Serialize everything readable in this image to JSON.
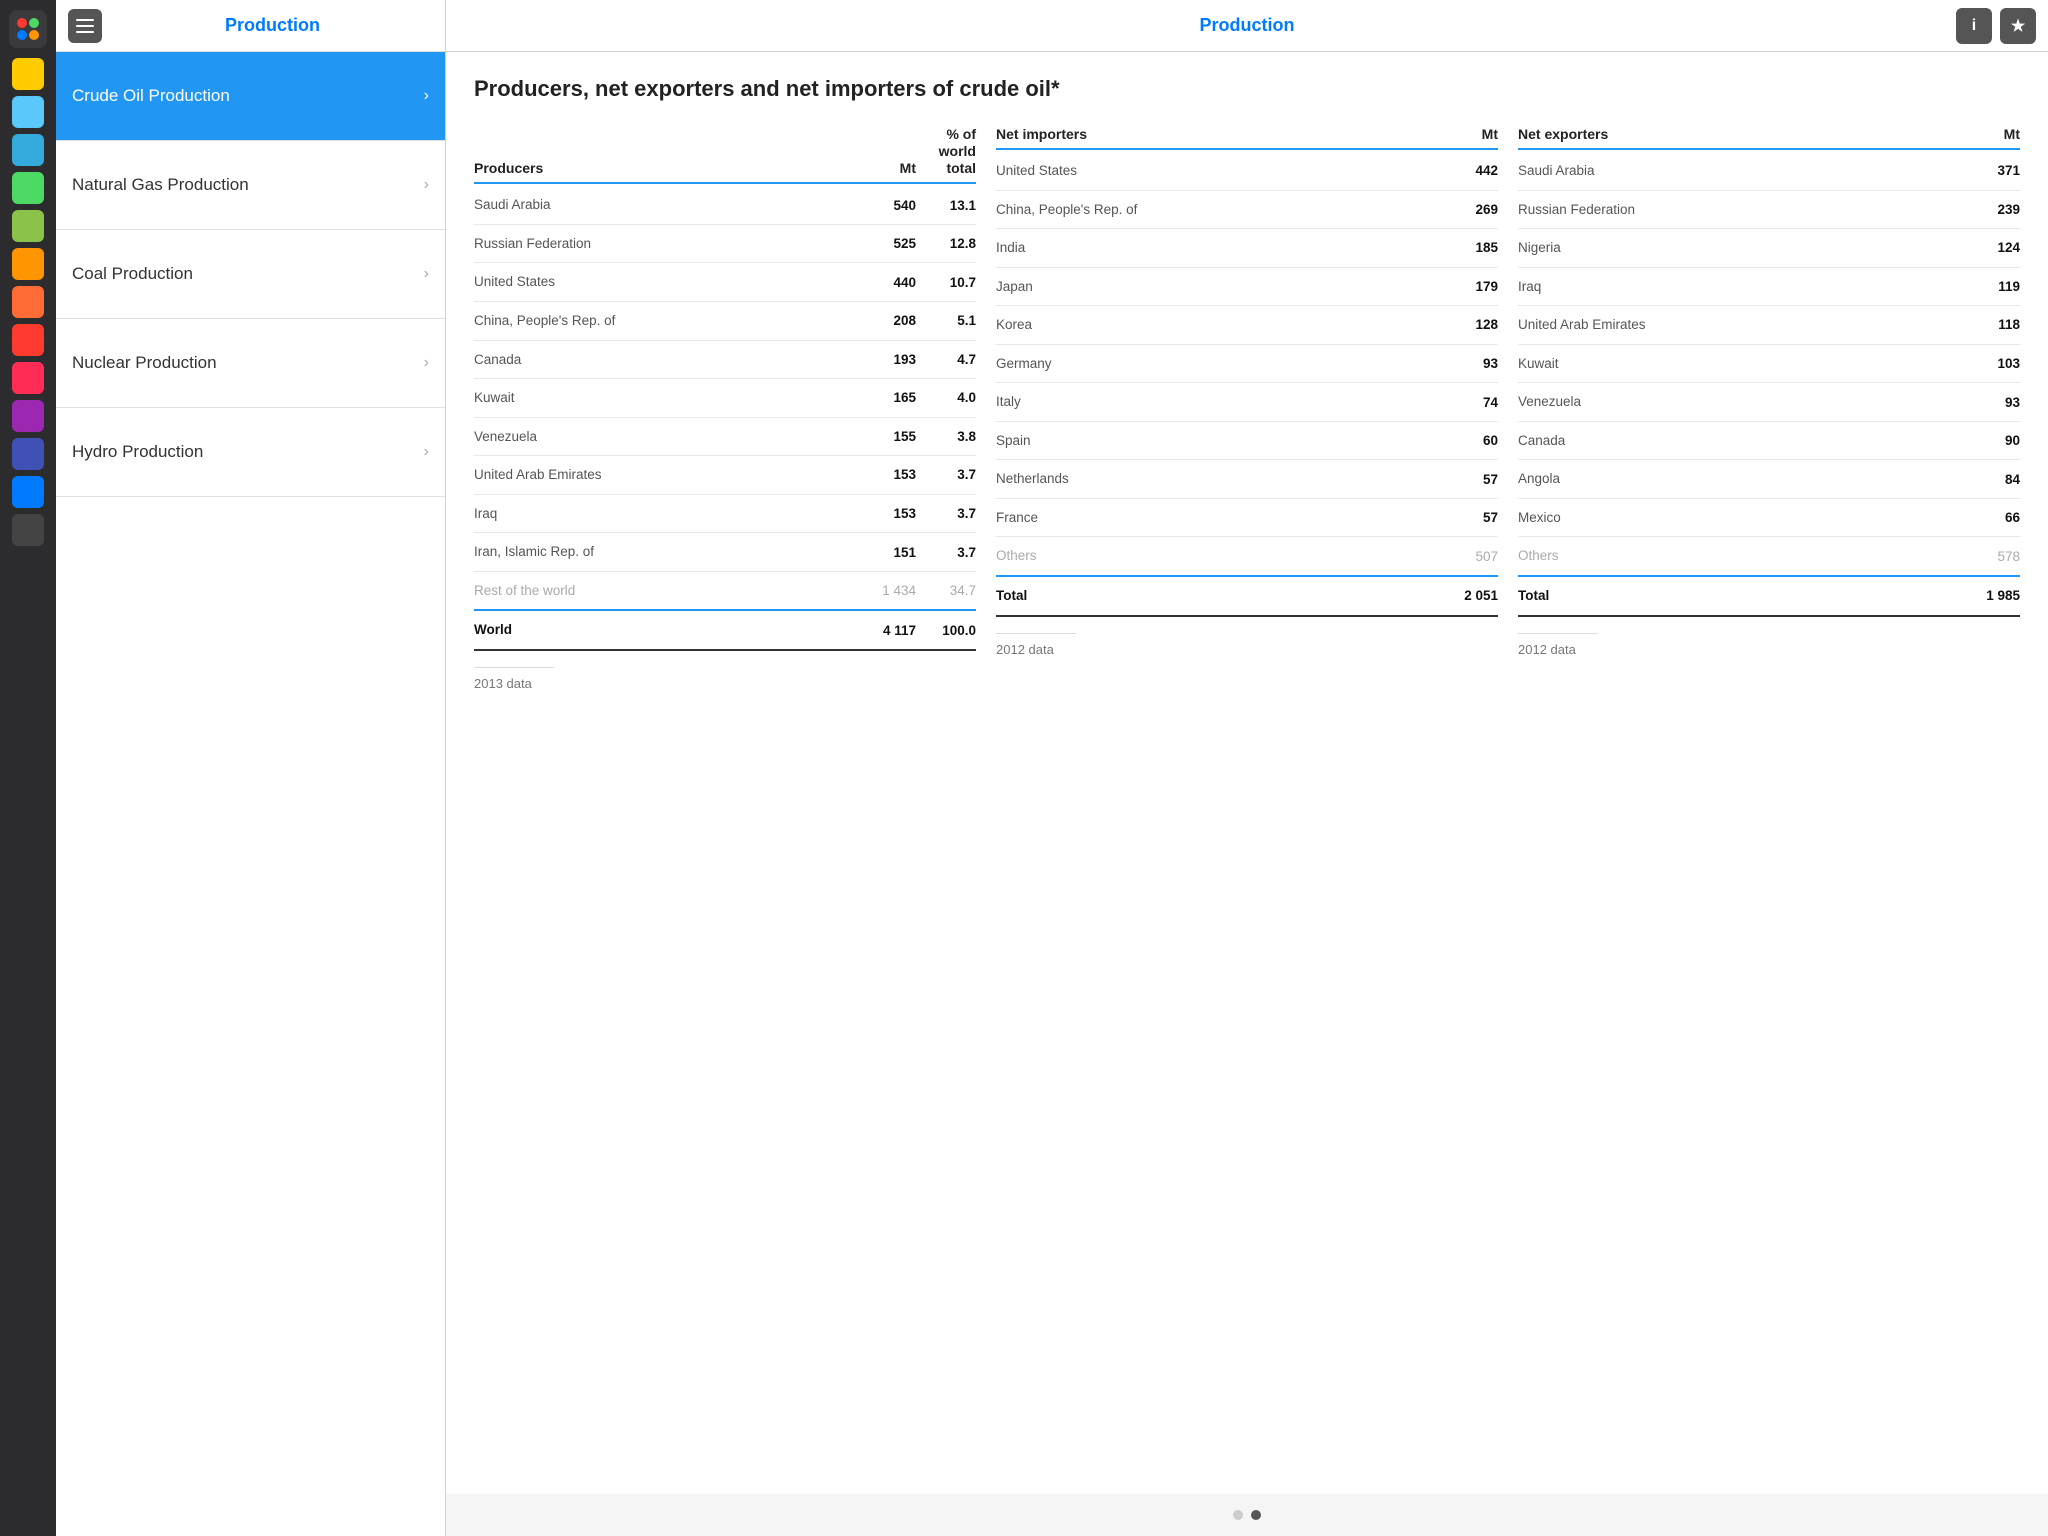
{
  "app": {
    "title": "Production",
    "main_title": "Production"
  },
  "sidebar": {
    "title": "Production",
    "items": [
      {
        "id": "crude-oil",
        "label": "Crude Oil Production",
        "active": true
      },
      {
        "id": "natural-gas",
        "label": "Natural Gas Production",
        "active": false
      },
      {
        "id": "coal",
        "label": "Coal Production",
        "active": false
      },
      {
        "id": "nuclear",
        "label": "Nuclear Production",
        "active": false
      },
      {
        "id": "hydro",
        "label": "Hydro Production",
        "active": false
      }
    ]
  },
  "icon_colors": [
    "#ffcc00",
    "#5ac8fa",
    "#34aadc",
    "#4cd964",
    "#8bc34a",
    "#ff9500",
    "#ff6b35",
    "#ff3b30",
    "#ff2d55",
    "#9c27b0",
    "#3f51b5",
    "#007aff",
    "#333333"
  ],
  "content": {
    "page_title": "Producers, net exporters and net importers of crude oil*",
    "producers": {
      "col_name": "Producers",
      "col_mt": "Mt",
      "col_pct_line1": "% of",
      "col_pct_line2": "world",
      "col_pct_line3": "total",
      "rows": [
        {
          "name": "Saudi Arabia",
          "mt": "540",
          "pct": "13.1"
        },
        {
          "name": "Russian Federation",
          "mt": "525",
          "pct": "12.8"
        },
        {
          "name": "United States",
          "mt": "440",
          "pct": "10.7"
        },
        {
          "name": "China, People's Rep. of",
          "mt": "208",
          "pct": "5.1"
        },
        {
          "name": "Canada",
          "mt": "193",
          "pct": "4.7"
        },
        {
          "name": "Kuwait",
          "mt": "165",
          "pct": "4.0"
        },
        {
          "name": "Venezuela",
          "mt": "155",
          "pct": "3.8"
        },
        {
          "name": "United Arab Emirates",
          "mt": "153",
          "pct": "3.7"
        },
        {
          "name": "Iraq",
          "mt": "153",
          "pct": "3.7"
        },
        {
          "name": "Iran, Islamic Rep. of",
          "mt": "151",
          "pct": "3.7"
        }
      ],
      "rest_row": {
        "name": "Rest of the world",
        "mt": "1 434",
        "pct": "34.7"
      },
      "total_row": {
        "name": "World",
        "mt": "4 117",
        "pct": "100.0"
      },
      "note": "2013 data"
    },
    "net_importers": {
      "col_name": "Net importers",
      "col_mt": "Mt",
      "rows": [
        {
          "name": "United States",
          "mt": "442"
        },
        {
          "name": "China, People's Rep. of",
          "mt": "269"
        },
        {
          "name": "India",
          "mt": "185"
        },
        {
          "name": "Japan",
          "mt": "179"
        },
        {
          "name": "Korea",
          "mt": "128"
        },
        {
          "name": "Germany",
          "mt": "93"
        },
        {
          "name": "Italy",
          "mt": "74"
        },
        {
          "name": "Spain",
          "mt": "60"
        },
        {
          "name": "Netherlands",
          "mt": "57"
        },
        {
          "name": "France",
          "mt": "57"
        }
      ],
      "others_row": {
        "name": "Others",
        "mt": "507"
      },
      "total_row": {
        "name": "Total",
        "mt": "2 051"
      },
      "note": "2012 data"
    },
    "net_exporters": {
      "col_name": "Net exporters",
      "col_mt": "Mt",
      "rows": [
        {
          "name": "Saudi Arabia",
          "mt": "371"
        },
        {
          "name": "Russian Federation",
          "mt": "239"
        },
        {
          "name": "Nigeria",
          "mt": "124"
        },
        {
          "name": "Iraq",
          "mt": "119"
        },
        {
          "name": "United Arab Emirates",
          "mt": "118"
        },
        {
          "name": "Kuwait",
          "mt": "103"
        },
        {
          "name": "Venezuela",
          "mt": "93"
        },
        {
          "name": "Canada",
          "mt": "90"
        },
        {
          "name": "Angola",
          "mt": "84"
        },
        {
          "name": "Mexico",
          "mt": "66"
        }
      ],
      "others_row": {
        "name": "Others",
        "mt": "578"
      },
      "total_row": {
        "name": "Total",
        "mt": "1 985"
      },
      "note": "2012 data"
    }
  },
  "pagination": {
    "dots": [
      false,
      true
    ]
  }
}
